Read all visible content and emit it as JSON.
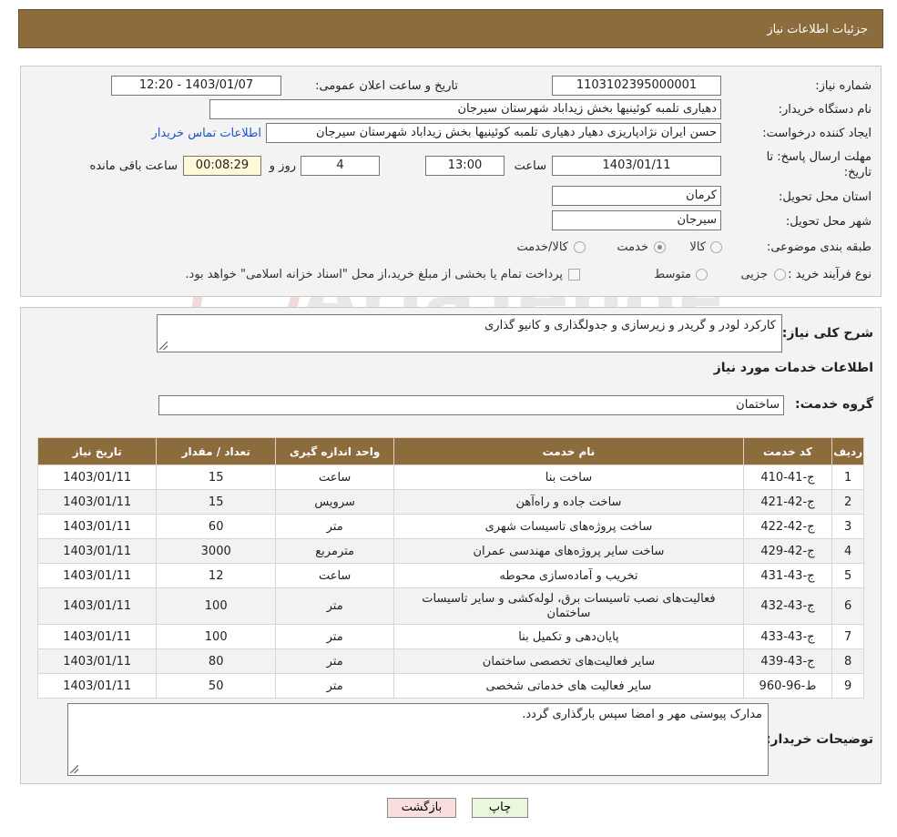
{
  "header": {
    "title": "جزئیات اطلاعات نیاز"
  },
  "need_info": {
    "need_number_label": "شماره نیاز:",
    "need_number": "1103102395000001",
    "announce_label": "تاریخ و ساعت اعلان عمومی:",
    "announce_value": "1403/01/07 - 12:20",
    "buyer_org_label": "نام دستگاه خریدار:",
    "buyer_org": "دهیاری تلمبه کوئینیها بخش زیداباد شهرستان سیرجان",
    "creator_label": "ایجاد کننده درخواست:",
    "creator": "حسن ایران نژادپاریزی دهیار دهیاری تلمبه کوئینیها بخش زیداباد شهرستان سیرجان",
    "contact_link": "اطلاعات تماس خریدار",
    "deadline_label_1": "مهلت ارسال پاسخ: تا",
    "deadline_label_2": "تاریخ:",
    "deadline_date": "1403/01/11",
    "time_label": "ساعت",
    "deadline_time": "13:00",
    "days_value": "4",
    "days_label": "روز و",
    "remaining_time": "00:08:29",
    "remaining_label": "ساعت باقی مانده",
    "province_label": "استان محل تحویل:",
    "province": "کرمان",
    "city_label": "شهر محل تحویل:",
    "city": "سیرجان",
    "category_label": "طبقه بندی موضوعی:",
    "category_options": [
      "کالا",
      "خدمت",
      "کالا/خدمت"
    ],
    "category_selected": "خدمت",
    "process_label": "نوع فرآیند خرید :",
    "process_options": [
      "جزیی",
      "متوسط"
    ],
    "payment_note": "پرداخت تمام یا بخشی از مبلغ خرید،از محل \"اسناد خزانه اسلامی\" خواهد بود."
  },
  "summary": {
    "label": "شرح کلی نیاز:",
    "value": "کارکرد لودر و گریدر و زیرسازی و جدولگذاری و کانیو گذاری"
  },
  "services": {
    "section_title": "اطلاعات خدمات مورد نیاز",
    "group_label": "گروه خدمت:",
    "group_value": "ساختمان",
    "columns": [
      "ردیف",
      "کد خدمت",
      "نام خدمت",
      "واحد اندازه گیری",
      "تعداد / مقدار",
      "تاریخ نیاز"
    ],
    "rows": [
      {
        "row": "1",
        "code": "ج-41-410",
        "name": "ساخت بنا",
        "unit": "ساعت",
        "qty": "15",
        "date": "1403/01/11"
      },
      {
        "row": "2",
        "code": "ج-42-421",
        "name": "ساخت جاده و راه‌آهن",
        "unit": "سرویس",
        "qty": "15",
        "date": "1403/01/11"
      },
      {
        "row": "3",
        "code": "ج-42-422",
        "name": "ساخت پروژه‌های تاسیسات شهری",
        "unit": "متر",
        "qty": "60",
        "date": "1403/01/11"
      },
      {
        "row": "4",
        "code": "ج-42-429",
        "name": "ساخت سایر پروژه‌های مهندسی عمران",
        "unit": "مترمربع",
        "qty": "3000",
        "date": "1403/01/11"
      },
      {
        "row": "5",
        "code": "ج-43-431",
        "name": "تخریب و آماده‌سازی محوطه",
        "unit": "ساعت",
        "qty": "12",
        "date": "1403/01/11"
      },
      {
        "row": "6",
        "code": "ج-43-432",
        "name": "فعالیت‌های نصب تاسیسات برق، لوله‌کشی و سایر تاسیسات ساختمان",
        "unit": "متر",
        "qty": "100",
        "date": "1403/01/11"
      },
      {
        "row": "7",
        "code": "ج-43-433",
        "name": "پایان‌دهی و تکمیل بنا",
        "unit": "متر",
        "qty": "100",
        "date": "1403/01/11"
      },
      {
        "row": "8",
        "code": "ج-43-439",
        "name": "سایر فعالیت‌های تخصصی ساختمان",
        "unit": "متر",
        "qty": "80",
        "date": "1403/01/11"
      },
      {
        "row": "9",
        "code": "ط-96-960",
        "name": "سایر فعالیت های خدماتی شخصی",
        "unit": "متر",
        "qty": "50",
        "date": "1403/01/11"
      }
    ]
  },
  "buyer_notes": {
    "label": "توضیحات خریدار:",
    "value": "مدارک پیوستی مهر و امضا سپس بارگذاری گردد."
  },
  "buttons": {
    "print": "چاپ",
    "back": "بازگشت"
  },
  "watermark": {
    "text": "AriaTender.neT"
  },
  "colors": {
    "header_bg": "#8c6b3c",
    "link": "#1a55c8"
  }
}
